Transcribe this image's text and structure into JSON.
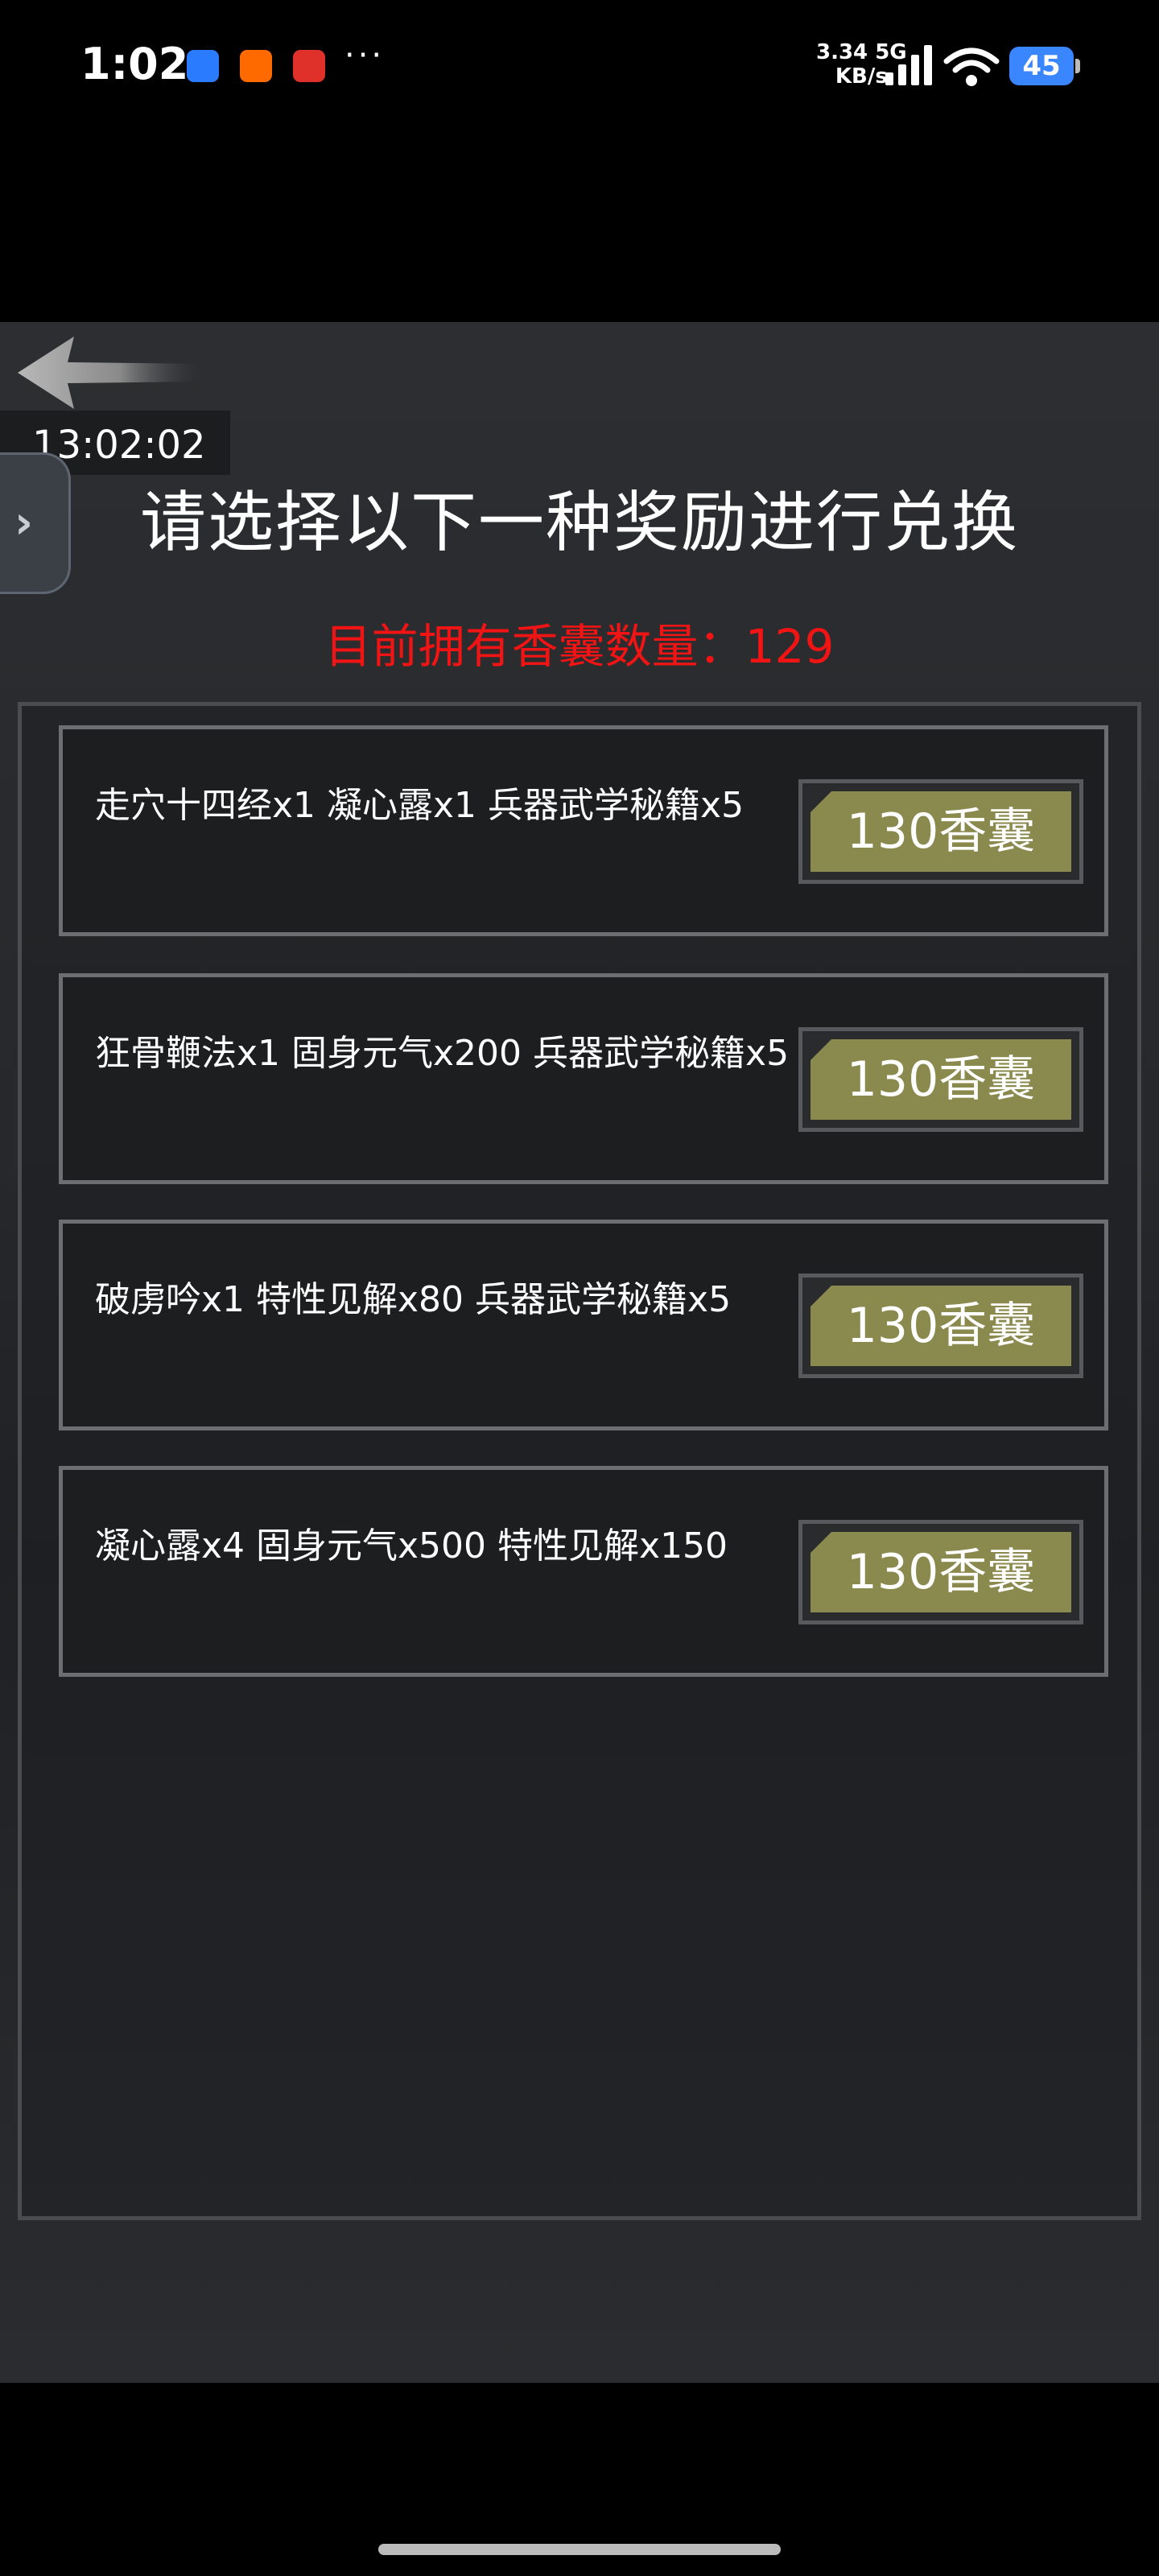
{
  "status_bar": {
    "time": "1:02",
    "net_speed_value": "3.34",
    "net_speed_unit": "KB/s",
    "net_type": "5G",
    "battery": "45",
    "overflow": "···"
  },
  "game": {
    "clock": "13:02:02",
    "side_tab_glyph": "›",
    "title": "请选择以下一种奖励进行兑换",
    "count_label": "目前拥有香囊数量：",
    "count_value": "129",
    "rewards": [
      {
        "text": "走穴十四经x1 凝心露x1 兵器武学秘籍x5",
        "cost": "130香囊"
      },
      {
        "text": "狂骨鞭法x1 固身元气x200 兵器武学秘籍x5",
        "cost": "130香囊"
      },
      {
        "text": "破虏吟x1 特性见解x80 兵器武学秘籍x5",
        "cost": "130香囊"
      },
      {
        "text": "凝心露x4 固身元气x500 特性见解x150",
        "cost": "130香囊"
      }
    ]
  },
  "colors": {
    "count_text": "#f01414",
    "button_fill": "#8b8a4e",
    "battery_fill": "#3a86ff"
  }
}
